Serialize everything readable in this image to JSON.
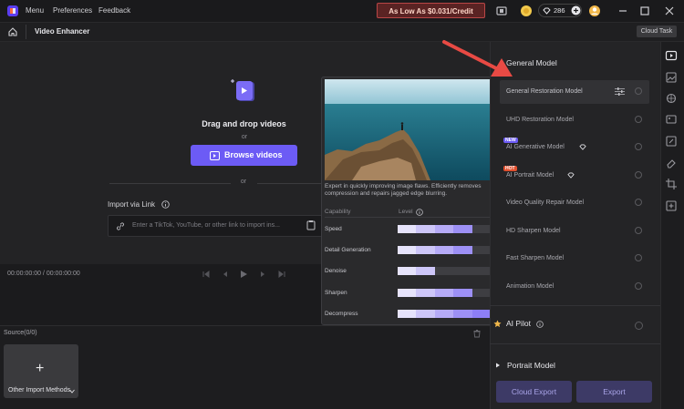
{
  "titlebar": {
    "menu_items": [
      "Menu",
      "Preferences",
      "Feedback"
    ],
    "promo": "As Low As $0.031/Credit",
    "credits": "286"
  },
  "subbar": {
    "breadcrumb": "Video Enhancer",
    "cloud_task": "Cloud Task"
  },
  "upload": {
    "title": "Drag and drop videos",
    "or_top": "or",
    "browse_label": "Browse videos",
    "or_bottom": "or",
    "import_label": "Import via Link",
    "link_placeholder": "Enter a TikTok, YouTube, or other link to import ins..."
  },
  "playback": {
    "timecode": "00:00:00:00 / 00:00:00:00"
  },
  "source": {
    "label": "Source(0/0)",
    "import_card_label": "Other Import Methods"
  },
  "popover": {
    "description": "Expert in quickly improving image flaws. Efficiently removes compression and repairs jagged edge blurring.",
    "capability_header": "Capability",
    "level_header": "Level",
    "capabilities": [
      {
        "label": "Speed",
        "level": 0.8
      },
      {
        "label": "Detail Generation",
        "level": 0.8
      },
      {
        "label": "Denoise",
        "level": 0.4
      },
      {
        "label": "Sharpen",
        "level": 0.8
      },
      {
        "label": "Decompress",
        "level": 1.0
      }
    ]
  },
  "models": {
    "title": "General Model",
    "items": [
      {
        "name": "General Restoration Model",
        "selected": true
      },
      {
        "name": "UHD Restoration Model"
      },
      {
        "name": "AI Generative Model",
        "badge": "NEW",
        "badge_color": "#6c5bf5",
        "diamond": true
      },
      {
        "name": "AI Portrait Model",
        "badge": "HOT",
        "badge_color": "#e0502f",
        "diamond": true
      },
      {
        "name": "Video Quality Repair Model"
      },
      {
        "name": "HD Sharpen Model"
      },
      {
        "name": "Fast Sharpen Model"
      },
      {
        "name": "Animation Model"
      }
    ],
    "ai_pilot": "AI Pilot",
    "portrait_model": "Portrait Model",
    "cloud_export": "Cloud Export",
    "export": "Export"
  },
  "colors": {
    "accent": "#6c5bf5",
    "arrow": "#e84a44",
    "level_fill": "#b6abf7",
    "level_strong": "#8d7ef5"
  }
}
